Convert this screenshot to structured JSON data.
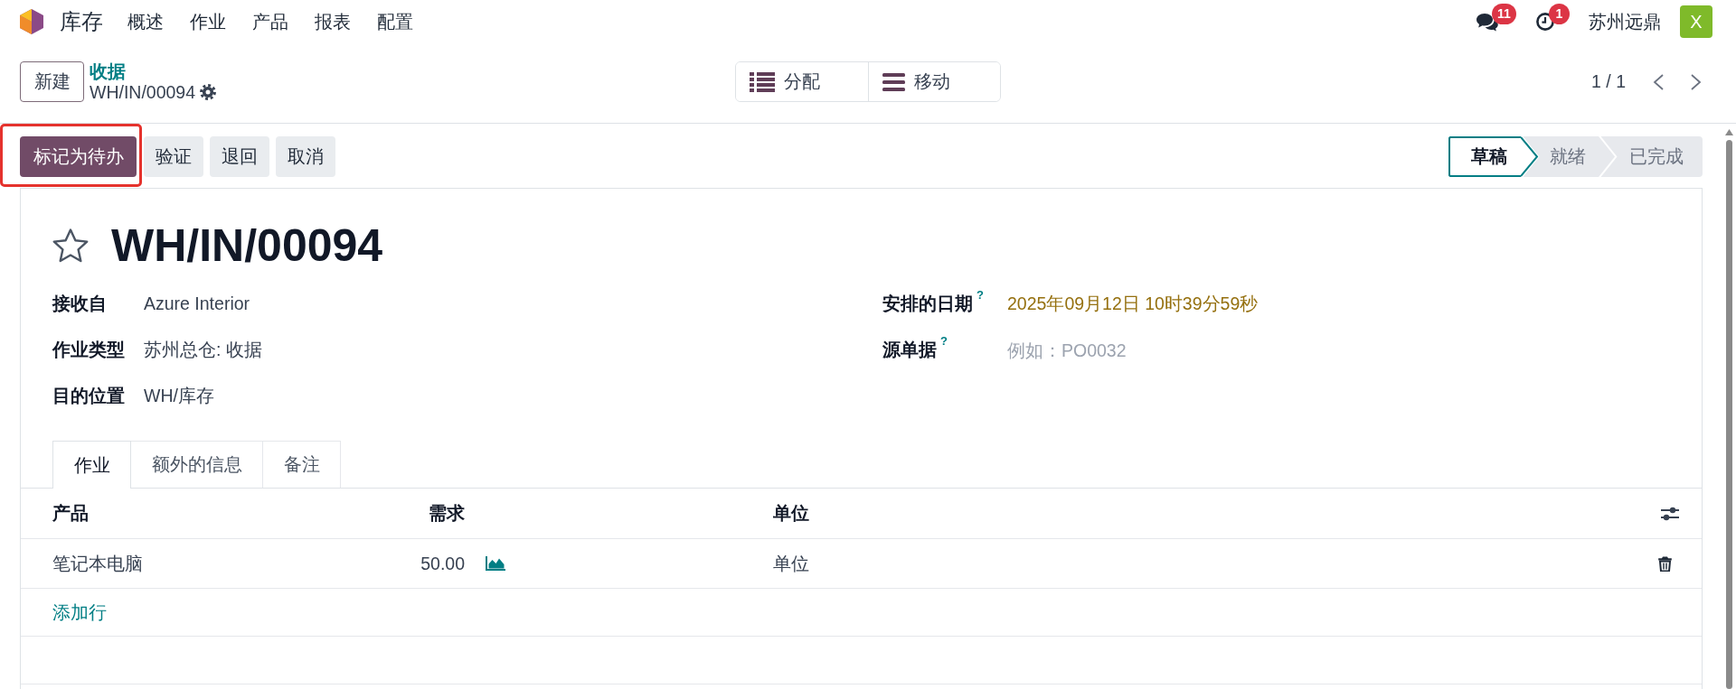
{
  "navbar": {
    "app_name": "库存",
    "menus": [
      "概述",
      "作业",
      "产品",
      "报表",
      "配置"
    ],
    "messages_badge": "11",
    "activities_badge": "1",
    "company": "苏州远鼎",
    "avatar_letter": "X"
  },
  "control_panel": {
    "new_button": "新建",
    "breadcrumb": "收据",
    "record_name": "WH/IN/00094",
    "smart_buttons": [
      {
        "label": "分配",
        "kind": "list"
      },
      {
        "label": "移动",
        "kind": "bars"
      }
    ],
    "pager": "1 / 1"
  },
  "actions": [
    {
      "label": "标记为待办",
      "kind": "primary",
      "highlighted": true
    },
    {
      "label": "验证",
      "kind": "secondary",
      "highlighted": false
    },
    {
      "label": "退回",
      "kind": "secondary",
      "highlighted": false
    },
    {
      "label": "取消",
      "kind": "secondary",
      "highlighted": false
    }
  ],
  "statusbar": [
    {
      "label": "草稿",
      "selected": true
    },
    {
      "label": "就绪",
      "selected": false
    },
    {
      "label": "已完成",
      "selected": false
    }
  ],
  "sheet": {
    "starred": false,
    "title": "WH/IN/00094",
    "left_fields": [
      {
        "label": "接收自",
        "value": "Azure Interior"
      },
      {
        "label": "作业类型",
        "value": "苏州总仓: 收据"
      },
      {
        "label": "目的位置",
        "value": "WH/库存"
      }
    ],
    "right_fields": [
      {
        "label": "安排的日期",
        "help": "?",
        "value": "2025年09月12日 10时39分59秒",
        "late": true
      },
      {
        "label": "源单据",
        "help": "?",
        "placeholder": "例如：PO0032"
      }
    ],
    "tabs": [
      {
        "label": "作业",
        "selected": true
      },
      {
        "label": "额外的信息",
        "selected": false
      },
      {
        "label": "备注",
        "selected": false
      }
    ],
    "table": {
      "columns": [
        {
          "label": "产品"
        },
        {
          "label": "需求"
        },
        {
          "label": "单位"
        }
      ],
      "rows": [
        {
          "product": "笔记本电脑",
          "demand": "50.00",
          "unit": "单位"
        }
      ],
      "add_line": "添加行"
    }
  }
}
